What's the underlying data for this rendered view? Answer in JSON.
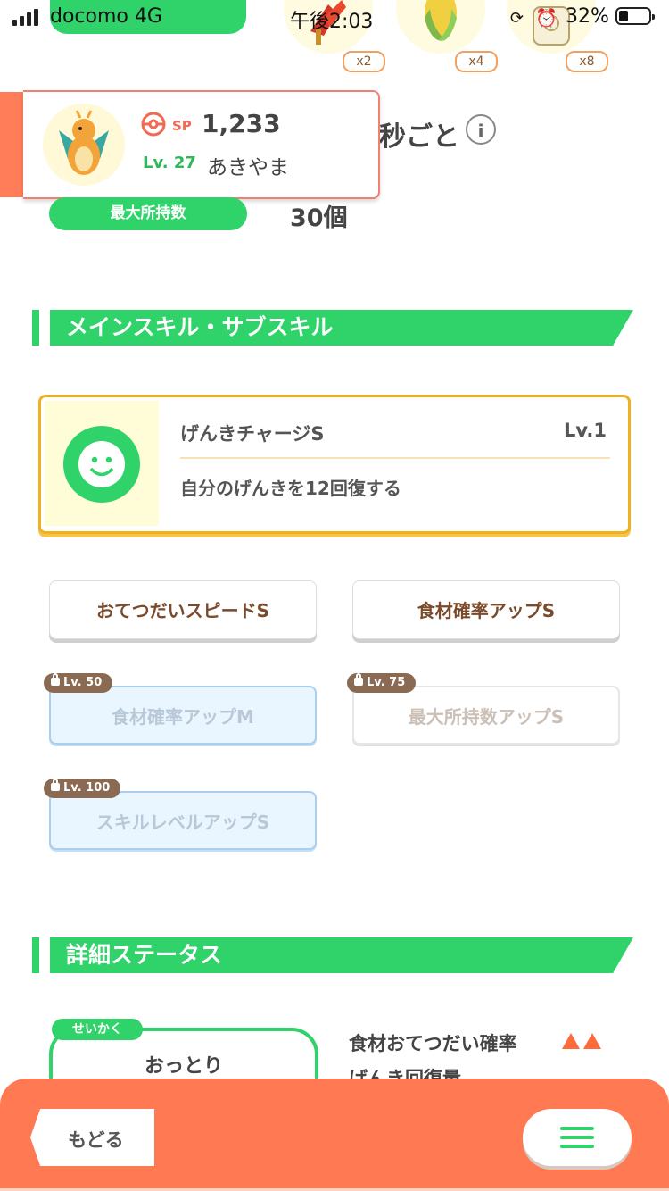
{
  "status_bar": {
    "carrier": "docomo",
    "network": "4G",
    "time": "午後2:03",
    "battery": "32%"
  },
  "ingredients": [
    {
      "name": "fiery-herb",
      "count": "x2"
    },
    {
      "name": "greengrass-corn",
      "count": "x4"
    },
    {
      "name": "moomoo-milk",
      "count": "x8"
    }
  ],
  "header_partial": {
    "seconds_text": "秒ごと"
  },
  "pokemon": {
    "sp_label": "SP",
    "sp_value": "1,233",
    "level_label": "Lv. 27",
    "nickname": "あきやま"
  },
  "carry": {
    "label": "最大所持数",
    "value": "30個"
  },
  "skills_section": {
    "title": "メインスキル・サブスキル",
    "main_skill": {
      "name": "げんきチャージS",
      "level": "Lv.1",
      "description": "自分のげんきを12回復する"
    },
    "sub_skills": [
      {
        "label": "おてつだいスピードS",
        "lock": ""
      },
      {
        "label": "食材確率アップS",
        "lock": ""
      },
      {
        "label": "食材確率アップM",
        "lock": "Lv. 50"
      },
      {
        "label": "最大所持数アップS",
        "lock": "Lv. 75"
      },
      {
        "label": "スキルレベルアップS",
        "lock": "Lv. 100"
      }
    ]
  },
  "detail_section": {
    "title": "詳細ステータス",
    "nature_tag": "せいかく",
    "nature": "おっとり",
    "stat_up": "食材おてつだい確率",
    "stat_down": "げんき回復量"
  },
  "bottom_bar": {
    "back_label": "もどる"
  },
  "colors": {
    "accent_green": "#2fd36a",
    "accent_orange": "#ff7a52",
    "skill_border": "#f0b020"
  }
}
